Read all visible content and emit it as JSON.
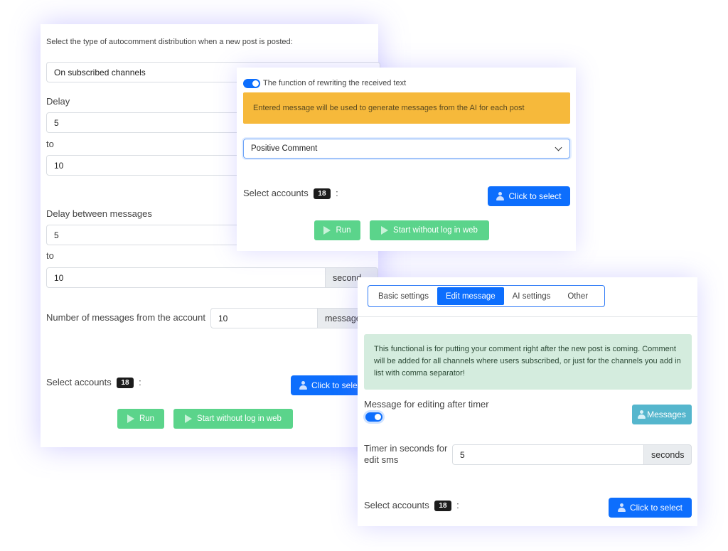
{
  "back": {
    "distribution_label": "Select the type of autocomment distribution when a new post is posted:",
    "distribution_value": "On subscribed channels",
    "delay_label": "Delay",
    "delay_from": "5",
    "to_label_1": "to",
    "delay_to": "10",
    "delay_between_label": "Delay between messages",
    "between_from": "5",
    "to_label_2": "to",
    "between_to": "10",
    "seconds_addon": "second",
    "num_messages_label": "Number of messages from the account",
    "num_messages_value": "10",
    "messages_addon": "message",
    "select_accounts_label": "Select accounts",
    "accounts_count": "18",
    "colon": ":",
    "click_to_select": "Click to select",
    "run_label": "Run",
    "start_label": "Start without log in web"
  },
  "mid": {
    "rewrite_toggle_label": "The function of rewriting the received text",
    "warning_text": "Entered message will be used to generate messages from the AI for each post",
    "select_value": "Positive Comment",
    "select_accounts_label": "Select accounts",
    "accounts_count": "18",
    "colon": ":",
    "click_to_select": "Click to select",
    "run_label": "Run",
    "start_label": "Start without log in web"
  },
  "front": {
    "tabs": [
      {
        "label": "Basic settings"
      },
      {
        "label": "Edit message"
      },
      {
        "label": "AI settings"
      },
      {
        "label": "Other"
      }
    ],
    "info_text": "This functional is for putting your comment right after the new post is coming. Comment will be added for all channels where users subscribed, or just for the channels you add in list with comma separator!",
    "edit_after_timer_label": "Message for editing after timer",
    "messages_button": "Messages",
    "timer_label": "Timer in seconds for edit sms",
    "timer_value": "5",
    "seconds_addon": "seconds",
    "select_accounts_label": "Select accounts",
    "accounts_count": "18",
    "colon": ":",
    "click_to_select": "Click to select"
  },
  "colors": {
    "primary": "#0d6efd",
    "success": "#5bd48b",
    "warning": "#f6b93b",
    "info": "#55b6cd",
    "alert_success_bg": "#d4ecde"
  }
}
